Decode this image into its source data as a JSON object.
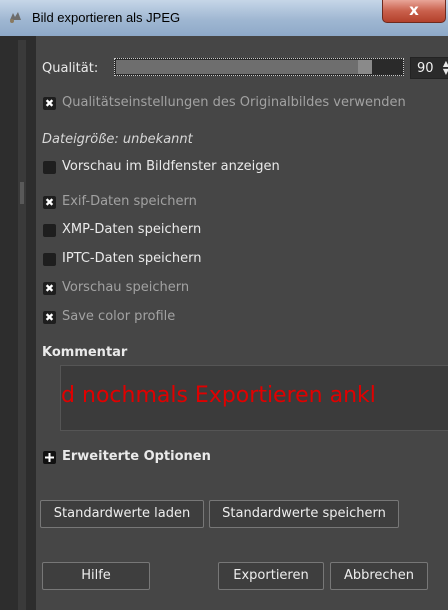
{
  "window": {
    "title": "Bild exportieren als JPEG",
    "close_label": "x"
  },
  "quality": {
    "label": "Qualität:",
    "value": "90",
    "fraction": 0.9,
    "up_arrow": "▲",
    "down_arrow": "▼"
  },
  "checkboxes": [
    {
      "label": "Qualitätseinstellungen des Originalbildes verwenden",
      "checked": true
    },
    {
      "label": "Vorschau im Bildfenster anzeigen",
      "checked": false
    },
    {
      "label": "Exif-Daten speichern",
      "checked": true
    },
    {
      "label": "XMP-Daten speichern",
      "checked": false
    },
    {
      "label": "IPTC-Daten speichern",
      "checked": false
    },
    {
      "label": "Vorschau speichern",
      "checked": true
    },
    {
      "label": "Save color profile",
      "checked": true
    }
  ],
  "filesize": "Dateigröße: unbekannt",
  "comment": {
    "heading": "Kommentar",
    "text": "Und nochmals Exportieren ankl"
  },
  "advanced": {
    "label": "Erweiterte Optionen",
    "icon": "plus-icon"
  },
  "buttons": {
    "load_defaults": "Standardwerte laden",
    "save_defaults": "Standardwerte speichern",
    "help": "Hilfe",
    "export": "Exportieren",
    "cancel": "Abbrechen"
  },
  "check_mark": "✖",
  "colors": {
    "comment_text": "#e00000",
    "dialog_bg": "#464646",
    "titlebar": "#9fb7d2"
  }
}
